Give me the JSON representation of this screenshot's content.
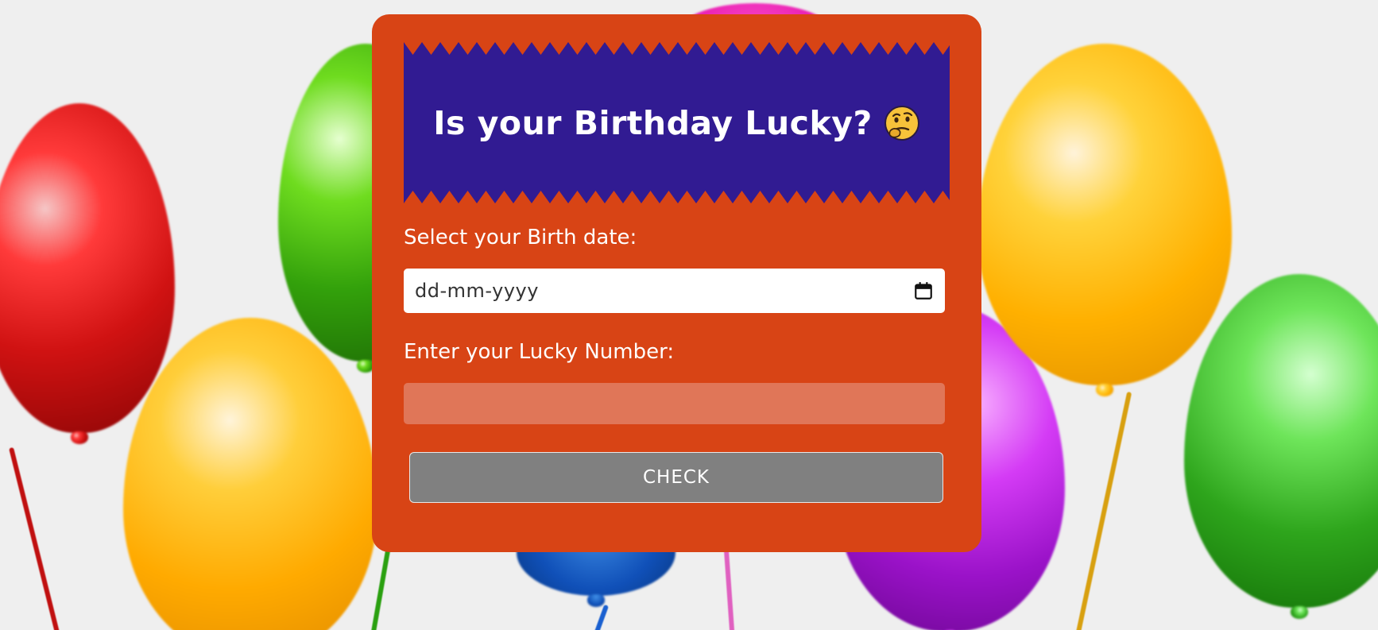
{
  "page": {
    "background_color": "#efefef"
  },
  "card": {
    "background_color": "#d84415",
    "banner": {
      "title": "Is your Birthday Lucky?",
      "icon": "thinking-face-icon",
      "background_color": "#311b92"
    },
    "birth_date": {
      "label": "Select your Birth date:",
      "placeholder": "dd-mm-yyyy",
      "icon": "calendar-icon"
    },
    "lucky_number": {
      "label": "Enter your Lucky Number:",
      "value": "",
      "field_color": "#e07658"
    },
    "check_button": {
      "label": "CHECK",
      "background_color": "#808080"
    }
  },
  "background": {
    "balloon_colors": [
      "red",
      "green",
      "yellow",
      "pink",
      "yellow",
      "purple",
      "blue",
      "green"
    ]
  }
}
